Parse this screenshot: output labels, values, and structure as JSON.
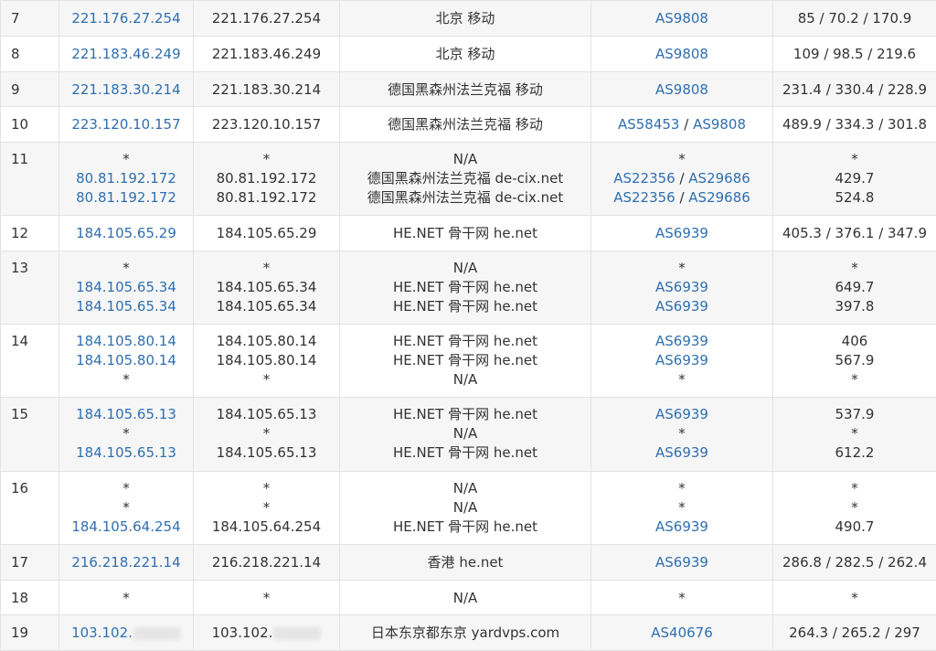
{
  "rows": [
    {
      "hop": "7",
      "entries": [
        {
          "ip": "221.176.27.254",
          "ip_link": true,
          "host": "221.176.27.254",
          "loc": "北京 移动",
          "asn": [
            "AS9808"
          ],
          "rtt": "85 / 70.2 / 170.9"
        }
      ]
    },
    {
      "hop": "8",
      "entries": [
        {
          "ip": "221.183.46.249",
          "ip_link": true,
          "host": "221.183.46.249",
          "loc": "北京 移动",
          "asn": [
            "AS9808"
          ],
          "rtt": "109 / 98.5 / 219.6"
        }
      ]
    },
    {
      "hop": "9",
      "entries": [
        {
          "ip": "221.183.30.214",
          "ip_link": true,
          "host": "221.183.30.214",
          "loc": "德国黑森州法兰克福 移动",
          "asn": [
            "AS9808"
          ],
          "rtt": "231.4 / 330.4 / 228.9"
        }
      ]
    },
    {
      "hop": "10",
      "entries": [
        {
          "ip": "223.120.10.157",
          "ip_link": true,
          "host": "223.120.10.157",
          "loc": "德国黑森州法兰克福 移动",
          "asn": [
            "AS58453",
            "AS9808"
          ],
          "rtt": "489.9 / 334.3 / 301.8"
        }
      ]
    },
    {
      "hop": "11",
      "entries": [
        {
          "ip": "*",
          "ip_link": false,
          "host": "*",
          "loc": "N/A",
          "asn": [
            "*"
          ],
          "rtt": "*"
        },
        {
          "ip": "80.81.192.172",
          "ip_link": true,
          "host": "80.81.192.172",
          "loc": "德国黑森州法兰克福 de-cix.net",
          "asn": [
            "AS22356",
            "AS29686"
          ],
          "rtt": "429.7"
        },
        {
          "ip": "80.81.192.172",
          "ip_link": true,
          "host": "80.81.192.172",
          "loc": "德国黑森州法兰克福 de-cix.net",
          "asn": [
            "AS22356",
            "AS29686"
          ],
          "rtt": "524.8"
        }
      ]
    },
    {
      "hop": "12",
      "entries": [
        {
          "ip": "184.105.65.29",
          "ip_link": true,
          "host": "184.105.65.29",
          "loc": "HE.NET 骨干网 he.net",
          "asn": [
            "AS6939"
          ],
          "rtt": "405.3 / 376.1 / 347.9"
        }
      ]
    },
    {
      "hop": "13",
      "entries": [
        {
          "ip": "*",
          "ip_link": false,
          "host": "*",
          "loc": "N/A",
          "asn": [
            "*"
          ],
          "rtt": "*"
        },
        {
          "ip": "184.105.65.34",
          "ip_link": true,
          "host": "184.105.65.34",
          "loc": "HE.NET 骨干网 he.net",
          "asn": [
            "AS6939"
          ],
          "rtt": "649.7"
        },
        {
          "ip": "184.105.65.34",
          "ip_link": true,
          "host": "184.105.65.34",
          "loc": "HE.NET 骨干网 he.net",
          "asn": [
            "AS6939"
          ],
          "rtt": "397.8"
        }
      ]
    },
    {
      "hop": "14",
      "entries": [
        {
          "ip": "184.105.80.14",
          "ip_link": true,
          "host": "184.105.80.14",
          "loc": "HE.NET 骨干网 he.net",
          "asn": [
            "AS6939"
          ],
          "rtt": "406"
        },
        {
          "ip": "184.105.80.14",
          "ip_link": true,
          "host": "184.105.80.14",
          "loc": "HE.NET 骨干网 he.net",
          "asn": [
            "AS6939"
          ],
          "rtt": "567.9"
        },
        {
          "ip": "*",
          "ip_link": false,
          "host": "*",
          "loc": "N/A",
          "asn": [
            "*"
          ],
          "rtt": "*"
        }
      ]
    },
    {
      "hop": "15",
      "entries": [
        {
          "ip": "184.105.65.13",
          "ip_link": true,
          "host": "184.105.65.13",
          "loc": "HE.NET 骨干网 he.net",
          "asn": [
            "AS6939"
          ],
          "rtt": "537.9"
        },
        {
          "ip": "*",
          "ip_link": false,
          "host": "*",
          "loc": "N/A",
          "asn": [
            "*"
          ],
          "rtt": "*"
        },
        {
          "ip": "184.105.65.13",
          "ip_link": true,
          "host": "184.105.65.13",
          "loc": "HE.NET 骨干网 he.net",
          "asn": [
            "AS6939"
          ],
          "rtt": "612.2"
        }
      ]
    },
    {
      "hop": "16",
      "entries": [
        {
          "ip": "*",
          "ip_link": false,
          "host": "*",
          "loc": "N/A",
          "asn": [
            "*"
          ],
          "rtt": "*"
        },
        {
          "ip": "*",
          "ip_link": false,
          "host": "*",
          "loc": "N/A",
          "asn": [
            "*"
          ],
          "rtt": "*"
        },
        {
          "ip": "184.105.64.254",
          "ip_link": true,
          "host": "184.105.64.254",
          "loc": "HE.NET 骨干网 he.net",
          "asn": [
            "AS6939"
          ],
          "rtt": "490.7"
        }
      ]
    },
    {
      "hop": "17",
      "entries": [
        {
          "ip": "216.218.221.14",
          "ip_link": true,
          "host": "216.218.221.14",
          "loc": "香港 he.net",
          "asn": [
            "AS6939"
          ],
          "rtt": "286.8 / 282.5 / 262.4"
        }
      ]
    },
    {
      "hop": "18",
      "entries": [
        {
          "ip": "*",
          "ip_link": false,
          "host": "*",
          "loc": "N/A",
          "asn": [
            "*"
          ],
          "rtt": "*"
        }
      ]
    },
    {
      "hop": "19",
      "entries": [
        {
          "ip": "103.102.",
          "ip_link": true,
          "redacted": true,
          "host": "103.102.",
          "loc": "日本东京都东京 yardvps.com",
          "asn": [
            "AS40676"
          ],
          "rtt": "264.3 / 265.2 / 297"
        }
      ]
    }
  ],
  "asn_separator": " / ",
  "colors": {
    "link": "#2f6fb0",
    "text": "#333333",
    "row_alt": "#f6f6f6",
    "border": "#e3e3e3"
  }
}
